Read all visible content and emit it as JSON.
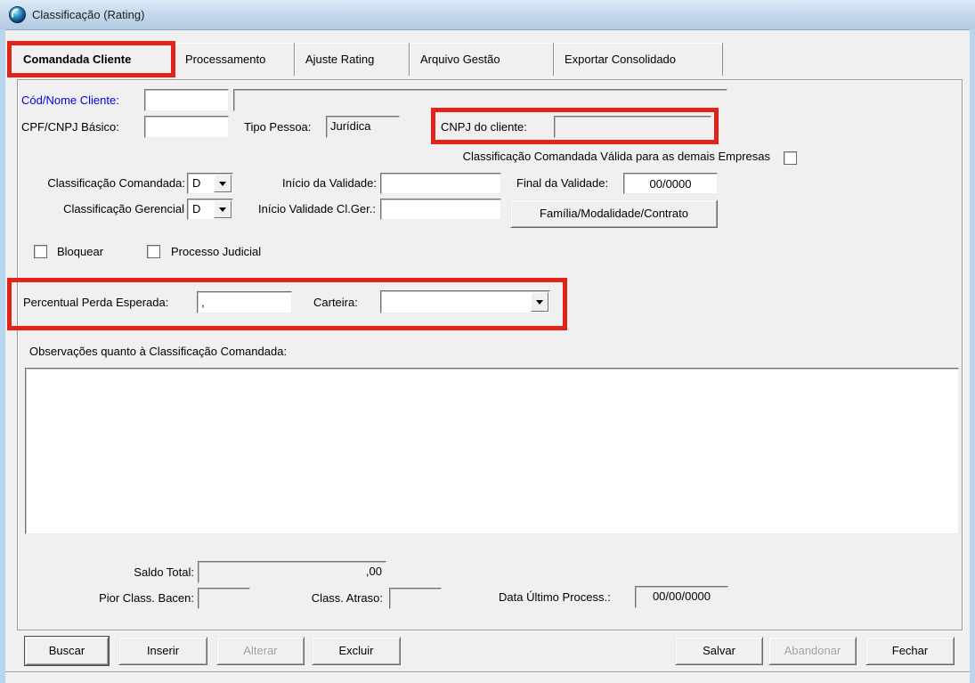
{
  "window": {
    "title": "Classificação (Rating)",
    "icon": "sphere-app-icon",
    "titlebar_color": "#c7d9ec",
    "frame_color": "#b9d4ee",
    "background_color": "#f0f0f0"
  },
  "tabs": [
    {
      "label": "Comandada Cliente",
      "selected": true
    },
    {
      "label": "Processamento",
      "selected": false
    },
    {
      "label": "Ajuste Rating",
      "selected": false
    },
    {
      "label": "Arquivo Gestão",
      "selected": false
    },
    {
      "label": "Exportar Consolidado",
      "selected": false
    }
  ],
  "form": {
    "cod_nome": {
      "label": "Cód/Nome Cliente:",
      "cod_value": "",
      "nome_value": "",
      "label_color": "#0000e6"
    },
    "cpf_cnpj": {
      "label": "CPF/CNPJ Básico:",
      "value": ""
    },
    "tipo_pessoa": {
      "label": "Tipo Pessoa:",
      "value": "Jurídica"
    },
    "cnpj_cliente": {
      "label": "CNPJ do cliente:",
      "value": ""
    },
    "valida_demais": {
      "label": "Classificação Comandada Válida para as demais Empresas",
      "checked": false
    },
    "class_comandada": {
      "label": "Classificação Comandada:",
      "value": "D"
    },
    "inicio_validade": {
      "label": "Início da Validade:",
      "value": ""
    },
    "final_validade": {
      "label": "Final da Validade:",
      "value": "00/0000"
    },
    "class_gerencial": {
      "label": "Classificação Gerencial",
      "value": "D"
    },
    "inicio_validade_ger": {
      "label": "Início Validade Cl.Ger.:",
      "value": ""
    },
    "familia_button_label": "Família/Modalidade/Contrato",
    "bloquear": {
      "label": "Bloquear",
      "checked": false
    },
    "processo_judicial": {
      "label": "Processo Judicial",
      "checked": false
    },
    "percentual_perda": {
      "label": "Percentual Perda Esperada:",
      "value": ","
    },
    "carteira": {
      "label": "Carteira:",
      "value": ""
    },
    "observacoes": {
      "label": "Observações quanto à Classificação Comandada:",
      "value": ""
    },
    "saldo_total": {
      "label": "Saldo Total:",
      "value": ",00"
    },
    "pior_class_bacen": {
      "label": "Pior Class. Bacen:",
      "value": ""
    },
    "class_atraso": {
      "label": "Class. Atraso:",
      "value": ""
    },
    "data_ultimo_process": {
      "label": "Data Último Process.:",
      "value": "00/00/0000"
    }
  },
  "buttons": {
    "buscar": "Buscar",
    "inserir": "Inserir",
    "alterar": "Alterar",
    "excluir": "Excluir",
    "salvar": "Salvar",
    "abandonar": "Abandonar",
    "fechar": "Fechar"
  },
  "annotations": {
    "highlight_color": "#e2231a",
    "boxes": [
      "comandada-cliente-tab",
      "cnpj-do-cliente-field",
      "percentual-perda-e-carteira-row"
    ]
  }
}
